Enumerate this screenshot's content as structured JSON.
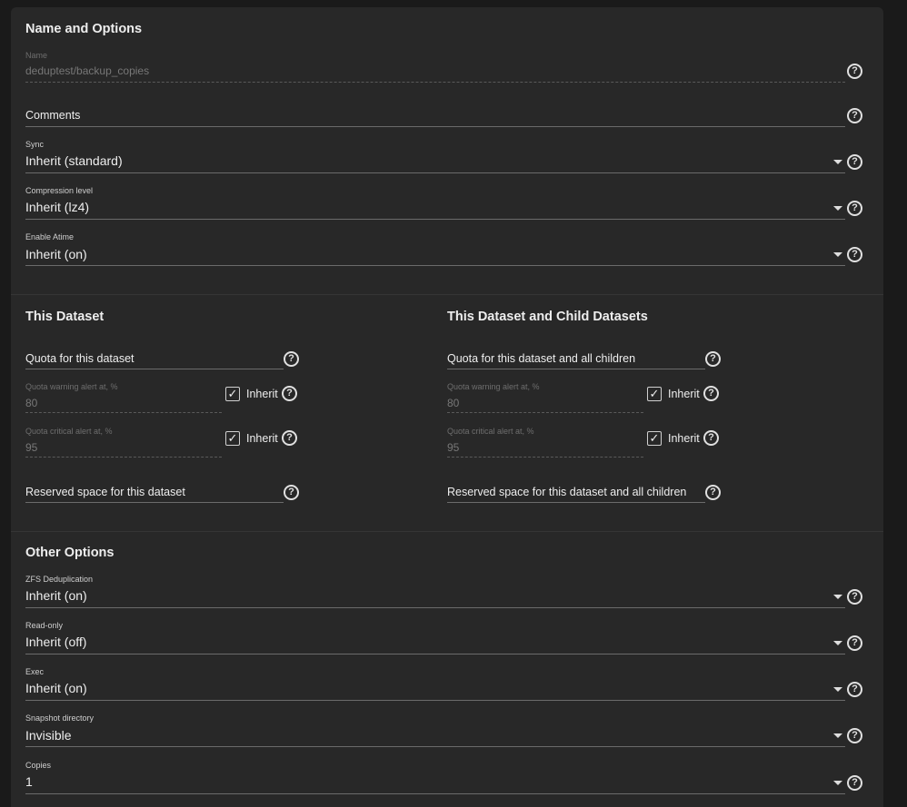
{
  "sections": {
    "name_options": "Name and Options",
    "this_dataset": "This Dataset",
    "child_datasets": "This Dataset and Child Datasets",
    "other_options": "Other Options"
  },
  "fields": {
    "name": {
      "label": "Name",
      "value": "deduptest/backup_copies"
    },
    "comments": {
      "placeholder": "Comments"
    },
    "sync": {
      "label": "Sync",
      "value": "Inherit (standard)"
    },
    "compression": {
      "label": "Compression level",
      "value": "Inherit (lz4)"
    },
    "atime": {
      "label": "Enable Atime",
      "value": "Inherit (on)"
    },
    "dedup": {
      "label": "ZFS Deduplication",
      "value": "Inherit (on)"
    },
    "readonly": {
      "label": "Read-only",
      "value": "Inherit (off)"
    },
    "exec": {
      "label": "Exec",
      "value": "Inherit (on)"
    },
    "snapdir": {
      "label": "Snapshot directory",
      "value": "Invisible"
    },
    "copies": {
      "label": "Copies",
      "value": "1"
    }
  },
  "this_dataset": {
    "quota": "Quota for this dataset",
    "warning": {
      "label": "Quota warning alert at, %",
      "value": "80",
      "inherit": "Inherit",
      "checked": true
    },
    "critical": {
      "label": "Quota critical alert at, %",
      "value": "95",
      "inherit": "Inherit",
      "checked": true
    },
    "reserved": "Reserved space for this dataset"
  },
  "children": {
    "quota": "Quota for this dataset and all children",
    "warning": {
      "label": "Quota warning alert at, %",
      "value": "80",
      "inherit": "Inherit",
      "checked": true
    },
    "critical": {
      "label": "Quota critical alert at, %",
      "value": "95",
      "inherit": "Inherit",
      "checked": true
    },
    "reserved": "Reserved space for this dataset and all children"
  },
  "icons": {
    "help": "?",
    "check": "✓"
  }
}
